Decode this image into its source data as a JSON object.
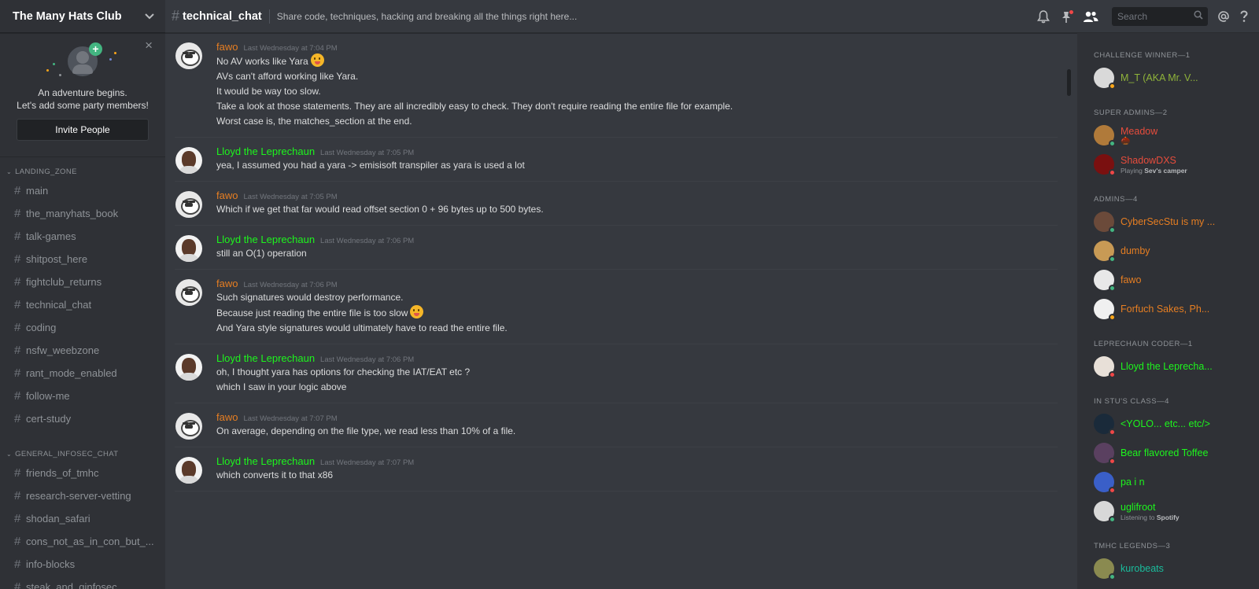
{
  "server": {
    "name": "The Many Hats Club"
  },
  "invite": {
    "line1": "An adventure begins.",
    "line2": "Let's add some party members!",
    "button": "Invite People",
    "close": "×"
  },
  "channel_categories": [
    {
      "name": "LANDING_ZONE",
      "channels": [
        "main",
        "the_manyhats_book",
        "talk-games",
        "shitpost_here",
        "fightclub_returns",
        "technical_chat",
        "coding",
        "nsfw_weebzone",
        "rant_mode_enabled",
        "follow-me",
        "cert-study"
      ]
    },
    {
      "name": "GENERAL_INFOSEC_CHAT",
      "channels": [
        "friends_of_tmhc",
        "research-server-vetting",
        "shodan_safari",
        "cons_not_as_in_con_but_...",
        "info-blocks",
        "steak_and_ginfosec"
      ]
    }
  ],
  "chat": {
    "channel": "technical_chat",
    "topic": "Share code, techniques, hacking and breaking all the things right here...",
    "search_placeholder": "Search"
  },
  "messages": [
    {
      "author": "fawo",
      "avatar": "bear",
      "color": "#e67e22",
      "time": "Last Wednesday at 7:04 PM",
      "lines": [
        "No AV works like Yara",
        "AVs can't afford working like Yara.",
        "It would be way too slow.",
        "Take a look at those statements. They are all incredibly easy to check. They don't require reading the entire file for example.",
        "Worst case is, the matches_section at the end."
      ],
      "emoji_lines": [
        0
      ]
    },
    {
      "author": "Lloyd the Leprechaun",
      "avatar": "lloyd",
      "color": "#1df51d",
      "time": "Last Wednesday at 7:05 PM",
      "lines": [
        "yea, I assumed you had a yara -> emisisoft transpiler as yara is used a lot"
      ],
      "emoji_lines": []
    },
    {
      "author": "fawo",
      "avatar": "bear",
      "color": "#e67e22",
      "time": "Last Wednesday at 7:05 PM",
      "lines": [
        "Which if we get that far would read offset section 0 + 96 bytes up to 500 bytes."
      ],
      "emoji_lines": []
    },
    {
      "author": "Lloyd the Leprechaun",
      "avatar": "lloyd",
      "color": "#1df51d",
      "time": "Last Wednesday at 7:06 PM",
      "lines": [
        "still an O(1) operation"
      ],
      "emoji_lines": []
    },
    {
      "author": "fawo",
      "avatar": "bear",
      "color": "#e67e22",
      "time": "Last Wednesday at 7:06 PM",
      "lines": [
        "Such signatures would destroy performance.",
        "Because just reading the entire file is too slow",
        "And Yara style signatures would ultimately have to read the entire file."
      ],
      "emoji_lines": [
        1
      ]
    },
    {
      "author": "Lloyd the Leprechaun",
      "avatar": "lloyd",
      "color": "#1df51d",
      "time": "Last Wednesday at 7:06 PM",
      "lines": [
        "oh, I thought yara has options for checking the IAT/EAT etc ?",
        "which I saw in your logic above"
      ],
      "emoji_lines": []
    },
    {
      "author": "fawo",
      "avatar": "bear",
      "color": "#e67e22",
      "time": "Last Wednesday at 7:07 PM",
      "lines": [
        "On average, depending on the file type, we read less than 10% of a file."
      ],
      "emoji_lines": []
    },
    {
      "author": "Lloyd the Leprechaun",
      "avatar": "lloyd",
      "color": "#1df51d",
      "time": "Last Wednesday at 7:07 PM",
      "lines": [
        "which converts it to that x86"
      ],
      "emoji_lines": []
    }
  ],
  "member_roles": [
    {
      "title": "CHALLENGE WINNER—1",
      "members": [
        {
          "name": "M_T (AKA Mr. V...",
          "color": "#8fb33a",
          "status": "#faa61a",
          "avatar": "#d9d9d9"
        }
      ]
    },
    {
      "title": "SUPER ADMINS—2",
      "members": [
        {
          "name": "Meadow",
          "color": "#e74c3c",
          "status": "#43b581",
          "avatar": "#b07a3a",
          "badge": true
        },
        {
          "name": "ShadowDXS",
          "color": "#e74c3c",
          "status": "#f04747",
          "avatar": "#7a1010",
          "activity_prefix": "Playing",
          "activity": "Sev's camper"
        }
      ]
    },
    {
      "title": "ADMINS—4",
      "members": [
        {
          "name": "CyberSecStu is my ...",
          "color": "#e67e22",
          "status": "#43b581",
          "avatar": "#6b4a3a"
        },
        {
          "name": "dumby",
          "color": "#e67e22",
          "status": "#43b581",
          "avatar": "#c89a55"
        },
        {
          "name": "fawo",
          "color": "#e67e22",
          "status": "#43b581",
          "avatar": "#e8e8e8"
        },
        {
          "name": "Forfuch Sakes, Ph...",
          "color": "#e67e22",
          "status": "#faa61a",
          "avatar": "#f0f0f0"
        }
      ]
    },
    {
      "title": "LEPRECHAUN CODER—1",
      "members": [
        {
          "name": "Lloyd the Leprecha...",
          "color": "#1df51d",
          "status": "#f04747",
          "avatar": "#e8e0d8"
        }
      ]
    },
    {
      "title": "IN STU'S CLASS—4",
      "members": [
        {
          "name": "<YOLO... etc... etc/>",
          "color": "#1df51d",
          "status": "#f04747",
          "avatar": "#1a2a3a"
        },
        {
          "name": "Bear flavored Toffee",
          "color": "#1df51d",
          "status": "#f04747",
          "avatar": "#5a4060"
        },
        {
          "name": "pa i n",
          "color": "#1df51d",
          "status": "#f04747",
          "avatar": "#3a5fc8"
        },
        {
          "name": "uglifroot",
          "color": "#1df51d",
          "status": "#43b581",
          "avatar": "#d8d8d8",
          "activity_prefix": "Listening to",
          "activity": "Spotify"
        }
      ]
    },
    {
      "title": "TMHC LEGENDS—3",
      "members": [
        {
          "name": "kurobeats",
          "color": "#1abc9c",
          "status": "#43b581",
          "avatar": "#8a8a50"
        }
      ]
    }
  ]
}
